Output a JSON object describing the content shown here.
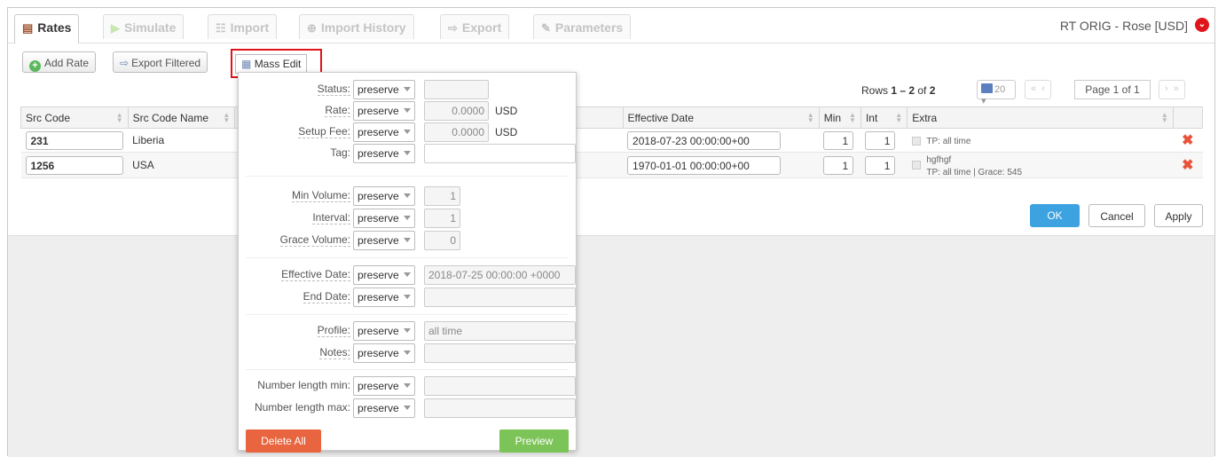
{
  "tabs": [
    {
      "label": "Rates",
      "icon": "rates-icon"
    },
    {
      "label": "Simulate",
      "icon": "play-icon"
    },
    {
      "label": "Import",
      "icon": "import-icon"
    },
    {
      "label": "Import History",
      "icon": "history-icon"
    },
    {
      "label": "Export",
      "icon": "export-icon"
    },
    {
      "label": "Parameters",
      "icon": "pencil-icon"
    }
  ],
  "header": {
    "title": "RT ORIG - Rose [USD]"
  },
  "toolbar": {
    "add_rate": "Add Rate",
    "export_filtered": "Export Filtered",
    "mass_edit": "Mass Edit"
  },
  "pager": {
    "rows_prefix": "Rows ",
    "rows_range": "1 – 2",
    "rows_of": " of ",
    "rows_total": "2",
    "per_page": "20",
    "page_label": "Page 1 of 1"
  },
  "table": {
    "headers": {
      "src_code": "Src Code",
      "src_code_name": "Src Code Name",
      "effective_date": "Effective Date",
      "min": "Min",
      "int": "Int",
      "extra": "Extra"
    },
    "rows": [
      {
        "src_code": "231",
        "src_code_name": "Liberia",
        "dash": "—",
        "effective_date": "2018-07-23 00:00:00+00",
        "min": "1",
        "int": "1",
        "extra_line1": "TP: all time",
        "extra_line2": ""
      },
      {
        "src_code": "1256",
        "src_code_name": "USA",
        "dash": "—",
        "effective_date": "1970-01-01 00:00:00+00",
        "min": "1",
        "int": "1",
        "extra_line1": "hgfhgf",
        "extra_line2": "TP: all time | Grace: 545"
      }
    ]
  },
  "actions": {
    "ok": "OK",
    "cancel": "Cancel",
    "apply": "Apply"
  },
  "mass_edit": {
    "preserve": "preserve",
    "status": {
      "label": "Status:",
      "value": ""
    },
    "rate": {
      "label": "Rate:",
      "value": "0.0000",
      "currency": "USD"
    },
    "setup_fee": {
      "label": "Setup Fee:",
      "value": "0.0000",
      "currency": "USD"
    },
    "tag": {
      "label": "Tag:",
      "value": ""
    },
    "min_volume": {
      "label": "Min Volume:",
      "value": "1"
    },
    "interval": {
      "label": "Interval:",
      "value": "1"
    },
    "grace_volume": {
      "label": "Grace Volume:",
      "value": "0"
    },
    "effective_date": {
      "label": "Effective Date:",
      "value": "2018-07-25 00:00:00 +0000"
    },
    "end_date": {
      "label": "End Date:",
      "value": ""
    },
    "profile": {
      "label": "Profile:",
      "value": "all time"
    },
    "notes": {
      "label": "Notes:",
      "value": ""
    },
    "number_length_min": {
      "label": "Number length min:",
      "value": ""
    },
    "number_length_max": {
      "label": "Number length max:",
      "value": ""
    },
    "delete_all": "Delete All",
    "preview": "Preview"
  }
}
